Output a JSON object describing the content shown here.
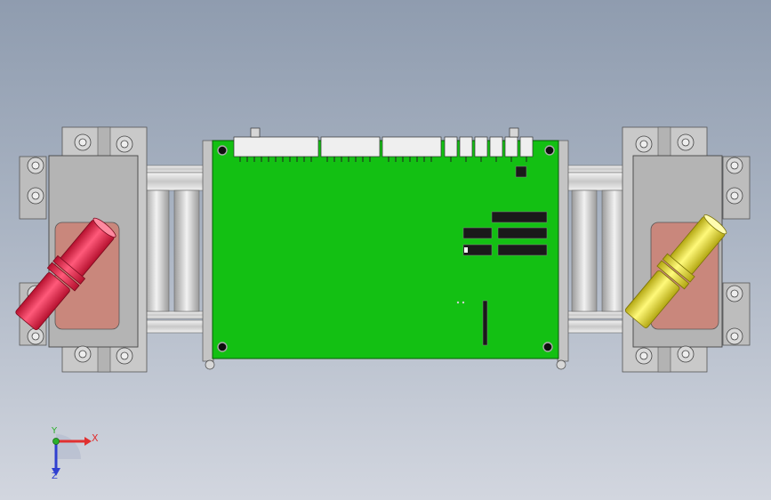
{
  "view": {
    "background_top": "#8f9caf",
    "background_bottom": "#d2d6df"
  },
  "model": {
    "board_color": "#13c013",
    "bracket_color": "#b9b9b9",
    "left_connector_color": "#e8204a",
    "right_connector_color": "#efe43a",
    "window_fill": "#c9877c"
  },
  "triad": {
    "x_label": "X",
    "y_label": "Y",
    "z_label": "Z",
    "x_color": "#e03030",
    "y_color": "#2ab02a",
    "z_color": "#3040d0"
  }
}
